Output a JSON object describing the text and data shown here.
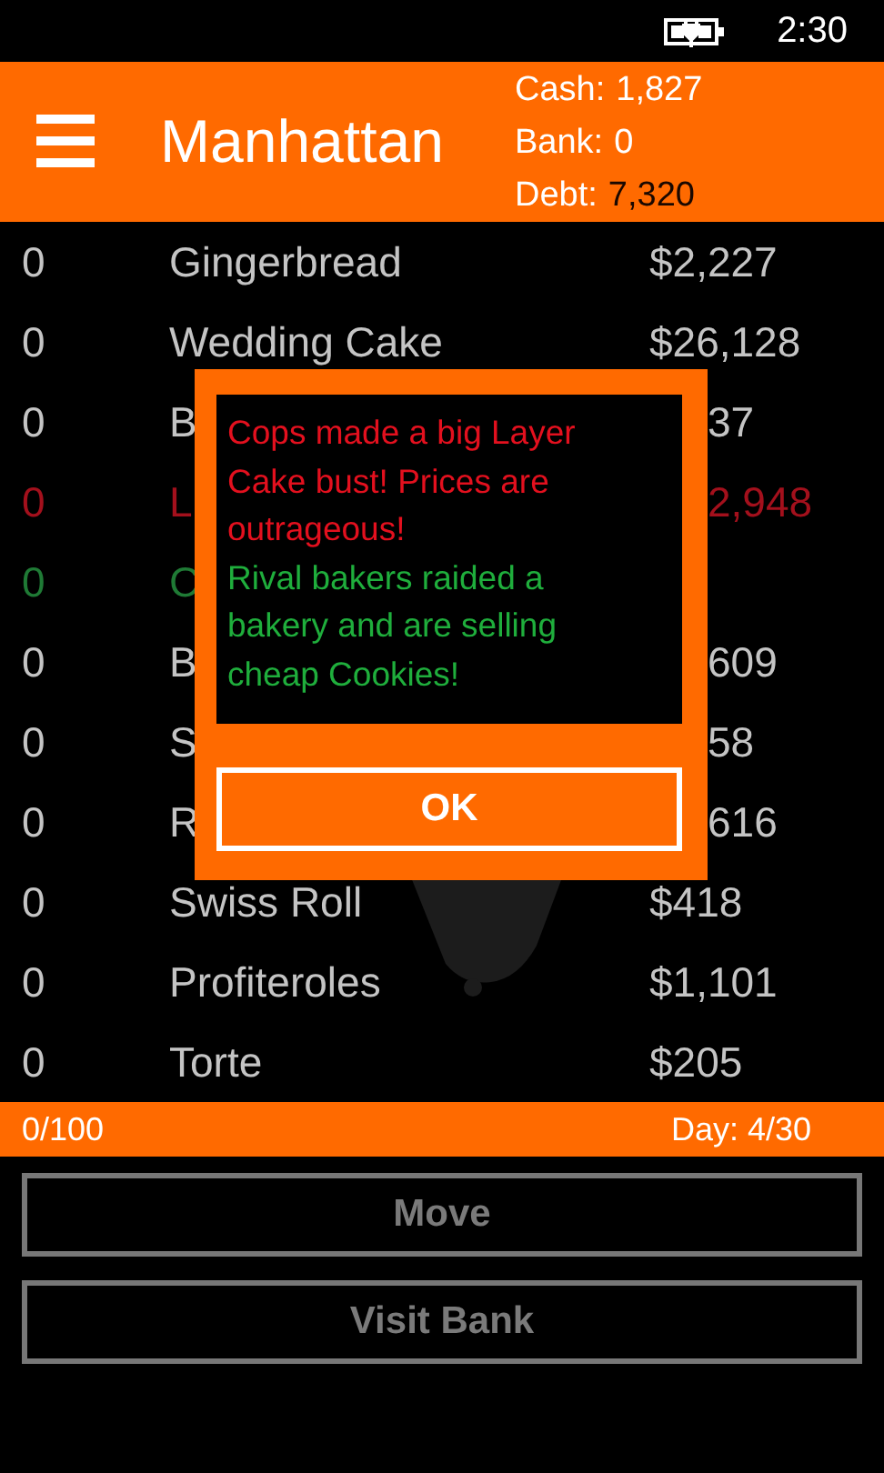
{
  "status_bar": {
    "time": "2:30"
  },
  "header": {
    "title": "Manhattan",
    "stats": [
      {
        "label": "Cash:",
        "value": "1,827",
        "highlight": false
      },
      {
        "label": "Bank:",
        "value": "0",
        "highlight": false
      },
      {
        "label": "Debt:",
        "value": "7,320",
        "highlight": true
      }
    ]
  },
  "items": [
    {
      "kind": "full",
      "qty": "0",
      "name": "Gingerbread",
      "price": "$2,227",
      "color": "#c4c4c4"
    },
    {
      "kind": "full",
      "qty": "0",
      "name": "Wedding Cake",
      "price": "$26,128",
      "color": "#c4c4c4"
    },
    {
      "kind": "covered",
      "qty": "0",
      "name": "B",
      "price": "37",
      "color": "#c4c4c4"
    },
    {
      "kind": "covered",
      "qty": "0",
      "name": "L",
      "price": "2,948",
      "color": "#a3101c"
    },
    {
      "kind": "covered",
      "qty": "0",
      "name": "C",
      "color": "#1f7a35"
    },
    {
      "kind": "covered",
      "qty": "0",
      "name": "B",
      "price": "609",
      "color": "#c4c4c4"
    },
    {
      "kind": "covered",
      "qty": "0",
      "name": "S",
      "price": "58",
      "color": "#c4c4c4"
    },
    {
      "kind": "covered",
      "qty": "0",
      "name": "R",
      "price": "616",
      "color": "#c4c4c4"
    },
    {
      "kind": "full",
      "qty": "0",
      "name": "Swiss Roll",
      "price": "$418",
      "color": "#c4c4c4"
    },
    {
      "kind": "full",
      "qty": "0",
      "name": "Profiteroles",
      "price": "$1,101",
      "color": "#c4c4c4"
    },
    {
      "kind": "full",
      "qty": "0",
      "name": "Torte",
      "price": "$205",
      "color": "#c4c4c4"
    }
  ],
  "footer": {
    "capacity": "0/100",
    "day": "Day: 4/30"
  },
  "buttons": [
    {
      "label": "Move",
      "disabled": true
    },
    {
      "label": "Visit Bank",
      "disabled": true
    }
  ],
  "dialog": {
    "messages": [
      {
        "color": "#e3101e",
        "text": "Cops made a big Layer Cake bust! Prices are outrageous!"
      },
      {
        "color": "#1fae3c",
        "text": "Rival bakers raided a bakery and are selling cheap Cookies!"
      }
    ],
    "button": "OK"
  }
}
